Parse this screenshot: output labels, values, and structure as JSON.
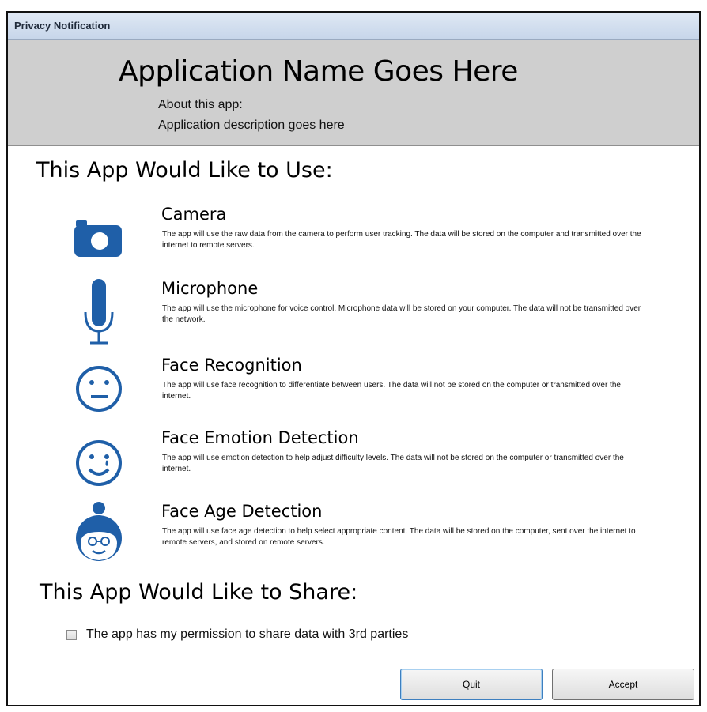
{
  "window": {
    "title": "Privacy Notification"
  },
  "header": {
    "app_name": "Application Name Goes Here",
    "about_label": "About this app:",
    "about_description": "Application description goes here"
  },
  "use_section": {
    "title": "This App Would Like to Use:",
    "items": [
      {
        "name": "Camera",
        "icon": "camera-icon",
        "description": "The app will use the raw data from the camera to perform user tracking. The data will be stored on the computer and transmitted over the internet to remote servers."
      },
      {
        "name": "Microphone",
        "icon": "microphone-icon",
        "description": "The app will use the microphone for voice control. Microphone data will be stored on your computer. The data will not be transmitted over the network."
      },
      {
        "name": "Face Recognition",
        "icon": "face-neutral-icon",
        "description": "The app will use face recognition to differentiate between users. The data will not be stored on the computer or transmitted over the internet."
      },
      {
        "name": "Face Emotion Detection",
        "icon": "face-smile-tear-icon",
        "description": "The app will use emotion detection to help adjust difficulty levels. The data will not be stored on the computer or transmitted over the internet."
      },
      {
        "name": "Face Age Detection",
        "icon": "face-elder-glasses-icon",
        "description": "The app will use face age detection to help select appropriate content. The data will be stored on the computer, sent over the internet to remote servers, and stored on remote servers."
      }
    ]
  },
  "share_section": {
    "title": "This App Would Like to Share:",
    "checkbox_label": "The app has my permission to share data with 3rd parties",
    "checked": false
  },
  "buttons": {
    "quit": "Quit",
    "accept": "Accept"
  },
  "colors": {
    "icon_blue": "#1f5fa8",
    "header_gray": "#cfcfcf",
    "title_bar": "#c7d6ea"
  }
}
